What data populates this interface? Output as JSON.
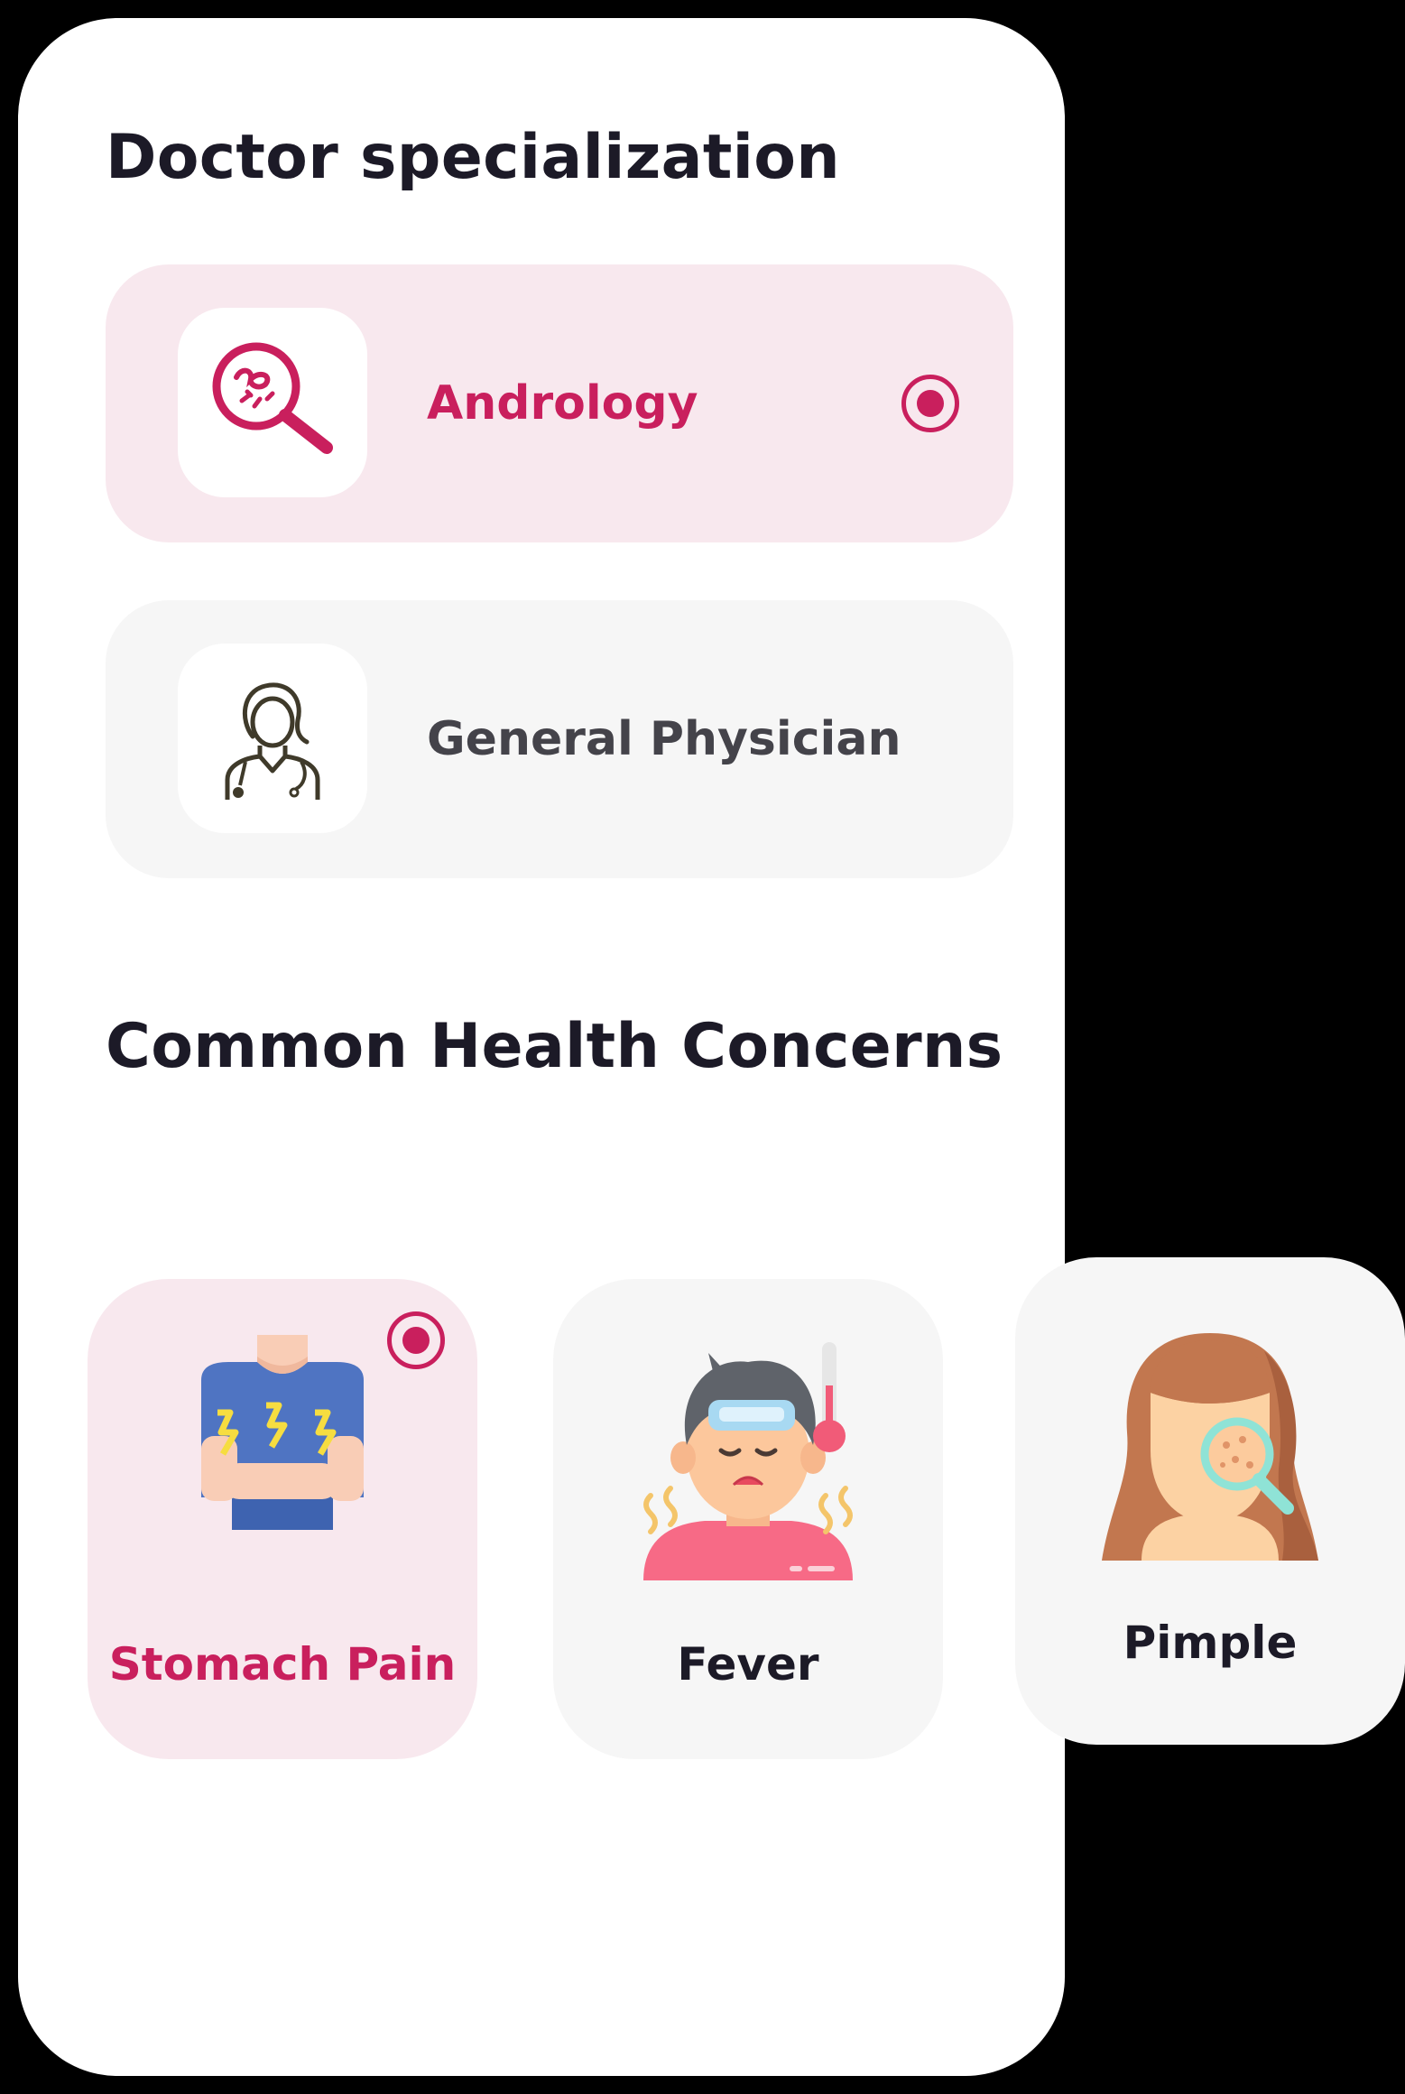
{
  "specialization": {
    "title": "Doctor specialization",
    "options": [
      {
        "label": "Andrology",
        "selected": true,
        "icon": "andrology-magnifier-icon"
      },
      {
        "label": "General Physician",
        "selected": false,
        "icon": "doctor-stethoscope-icon"
      }
    ]
  },
  "concerns": {
    "title": "Common Health Concerns",
    "items": [
      {
        "label": "Stomach Pain",
        "selected": true,
        "icon": "stomach-pain-illustration"
      },
      {
        "label": "Fever",
        "selected": false,
        "icon": "fever-illustration"
      },
      {
        "label": "Pimple",
        "selected": false,
        "icon": "pimple-illustration"
      }
    ]
  },
  "colors": {
    "accent": "#c91f5d",
    "selected_background": "#f8e8ee",
    "unselected_background": "#f6f6f6",
    "heading_text": "#1c1a27"
  }
}
